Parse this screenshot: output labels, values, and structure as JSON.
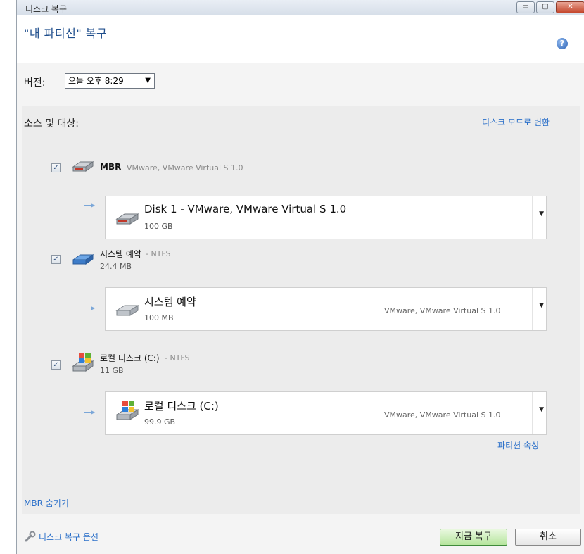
{
  "window": {
    "title": "디스크 복구",
    "controls": {
      "minimize": "▭",
      "maximize": "▢",
      "close": "✕"
    }
  },
  "header": {
    "page_title": "\"내 파티션\" 복구",
    "help_icon": "?"
  },
  "version": {
    "label": "버전:",
    "selected": "오늘 오후 8:29",
    "arrow": "▼"
  },
  "section": {
    "label": "소스 및 대상:",
    "toggle_mode_link": "디스크 모드로 변환"
  },
  "items": [
    {
      "checked": "✓",
      "name": "MBR",
      "detail": "VMware, VMware Virtual S 1.0",
      "size": "",
      "target": {
        "name": "Disk 1 - VMware, VMware Virtual S 1.0",
        "size": "100 GB",
        "desc": "",
        "arrow": "▼"
      }
    },
    {
      "checked": "✓",
      "name": "시스템 예약",
      "detail": "- NTFS",
      "size": "24.4 MB",
      "target": {
        "name": "시스템 예약",
        "size": "100 MB",
        "desc": "VMware, VMware Virtual S 1.0",
        "arrow": "▼"
      }
    },
    {
      "checked": "✓",
      "name": "로컬 디스크 (C:)",
      "detail": "- NTFS",
      "size": "11 GB",
      "target": {
        "name": "로컬 디스크 (C:)",
        "size": "99.9 GB",
        "desc": "VMware, VMware Virtual S 1.0",
        "arrow": "▼"
      }
    }
  ],
  "partition_properties_link": "파티션 속성",
  "hide_mbr_link": "MBR 숨기기",
  "footer": {
    "options_link": "디스크 복구 옵션",
    "recover_now": "지금 복구",
    "cancel": "취소"
  },
  "colors": {
    "accent": "#2a6fc9",
    "title_blue": "#1f4e8c",
    "primary_button": "#b6e59d"
  }
}
